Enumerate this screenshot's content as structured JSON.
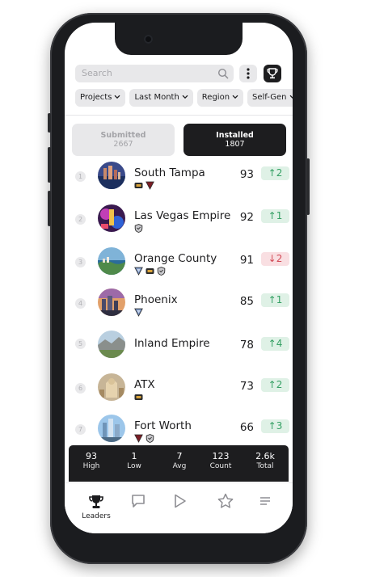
{
  "search": {
    "placeholder": "Search",
    "icon": "search-icon"
  },
  "toolbar": {
    "more_icon": "more-vertical-icon",
    "trophy_icon": "trophy-icon"
  },
  "filters": [
    {
      "label": "Projects"
    },
    {
      "label": "Last Month"
    },
    {
      "label": "Region"
    },
    {
      "label": "Self-Gen"
    }
  ],
  "segments": {
    "submitted": {
      "label": "Submitted",
      "count": "2667"
    },
    "installed": {
      "label": "Installed",
      "count": "1807"
    }
  },
  "leaderboard": [
    {
      "rank": "1",
      "name": "South Tampa",
      "score": "93",
      "change": "2",
      "direction": "up",
      "badges": [
        "gold",
        "maroon-triangle"
      ]
    },
    {
      "rank": "2",
      "name": "Las Vegas Empire",
      "score": "92",
      "change": "1",
      "direction": "up",
      "badges": [
        "silver-shield"
      ]
    },
    {
      "rank": "3",
      "name": "Orange County",
      "score": "91",
      "change": "2",
      "direction": "down",
      "badges": [
        "blue-triangle",
        "gold",
        "silver-shield"
      ]
    },
    {
      "rank": "4",
      "name": "Phoenix",
      "score": "85",
      "change": "1",
      "direction": "up",
      "badges": [
        "blue-triangle"
      ]
    },
    {
      "rank": "5",
      "name": "Inland Empire",
      "score": "78",
      "change": "4",
      "direction": "up",
      "badges": []
    },
    {
      "rank": "6",
      "name": "ATX",
      "score": "73",
      "change": "2",
      "direction": "up",
      "badges": [
        "gold"
      ]
    },
    {
      "rank": "7",
      "name": "Fort Worth",
      "score": "66",
      "change": "3",
      "direction": "up",
      "badges": [
        "maroon-triangle",
        "silver-shield"
      ]
    }
  ],
  "stats": [
    {
      "value": "93",
      "label": "High"
    },
    {
      "value": "1",
      "label": "Low"
    },
    {
      "value": "7",
      "label": "Avg"
    },
    {
      "value": "123",
      "label": "Count"
    },
    {
      "value": "2.6k",
      "label": "Total"
    }
  ],
  "tabs": [
    {
      "label": "Leaders",
      "icon": "trophy-icon",
      "active": true
    },
    {
      "label": "",
      "icon": "chat-icon",
      "active": false
    },
    {
      "label": "",
      "icon": "play-icon",
      "active": false
    },
    {
      "label": "",
      "icon": "star-icon",
      "active": false
    },
    {
      "label": "",
      "icon": "menu-icon",
      "active": false
    }
  ],
  "colors": {
    "dark": "#1d1d1f",
    "up_bg": "#dff1e6",
    "up_fg": "#35a064",
    "down_bg": "#f9dfe2",
    "down_fg": "#d24a56"
  }
}
